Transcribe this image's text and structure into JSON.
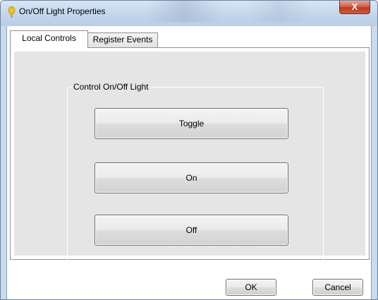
{
  "window": {
    "title": "On/Off Light Properties",
    "app_icon": "lightbulb-icon",
    "close_glyph": "X",
    "close_icon": "close-icon"
  },
  "tabs": [
    {
      "label": "Local Controls",
      "active": true
    },
    {
      "label": "Register Events",
      "active": false
    }
  ],
  "group": {
    "label": "Control On/Off Light"
  },
  "controls": {
    "toggle_label": "Toggle",
    "on_label": "On",
    "off_label": "Off"
  },
  "dialog": {
    "ok_label": "OK",
    "cancel_label": "Cancel"
  },
  "colors": {
    "titlebar": "#c2d6ec",
    "close_button": "#c0391c",
    "panel_background": "#e5e5e5",
    "bulb": "#f2c21a"
  }
}
